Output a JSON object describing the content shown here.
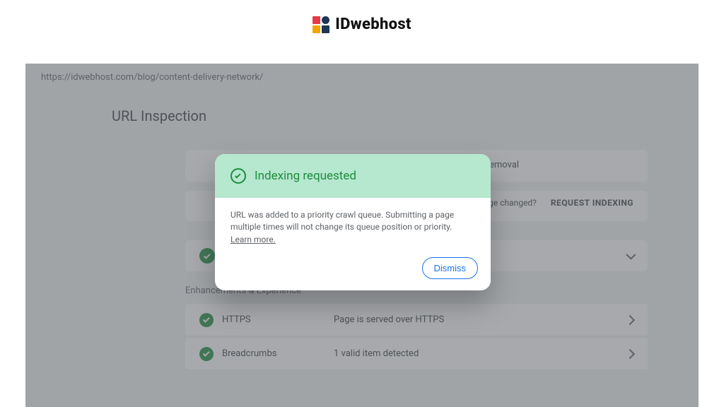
{
  "brand": {
    "name": "IDwebhost"
  },
  "url_inspected": "https://idwebhost.com/blog/content-delivery-network/",
  "page_title": "URL Inspection",
  "background": {
    "removal_fragment": "emoval",
    "page_changed_label": "Page changed?",
    "request_indexing_label": "REQUEST INDEXING"
  },
  "enhancements_section_label": "Enhancements & Experience",
  "rows": [
    {
      "name": "HTTPS",
      "detail": "Page is served over HTTPS"
    },
    {
      "name": "Breadcrumbs",
      "detail": "1 valid item detected"
    }
  ],
  "dialog": {
    "title": "Indexing requested",
    "body": "URL was added to a priority crawl queue. Submitting a page multiple times will not change its queue position or priority.",
    "learn_more": "Learn more.",
    "dismiss": "Dismiss"
  }
}
